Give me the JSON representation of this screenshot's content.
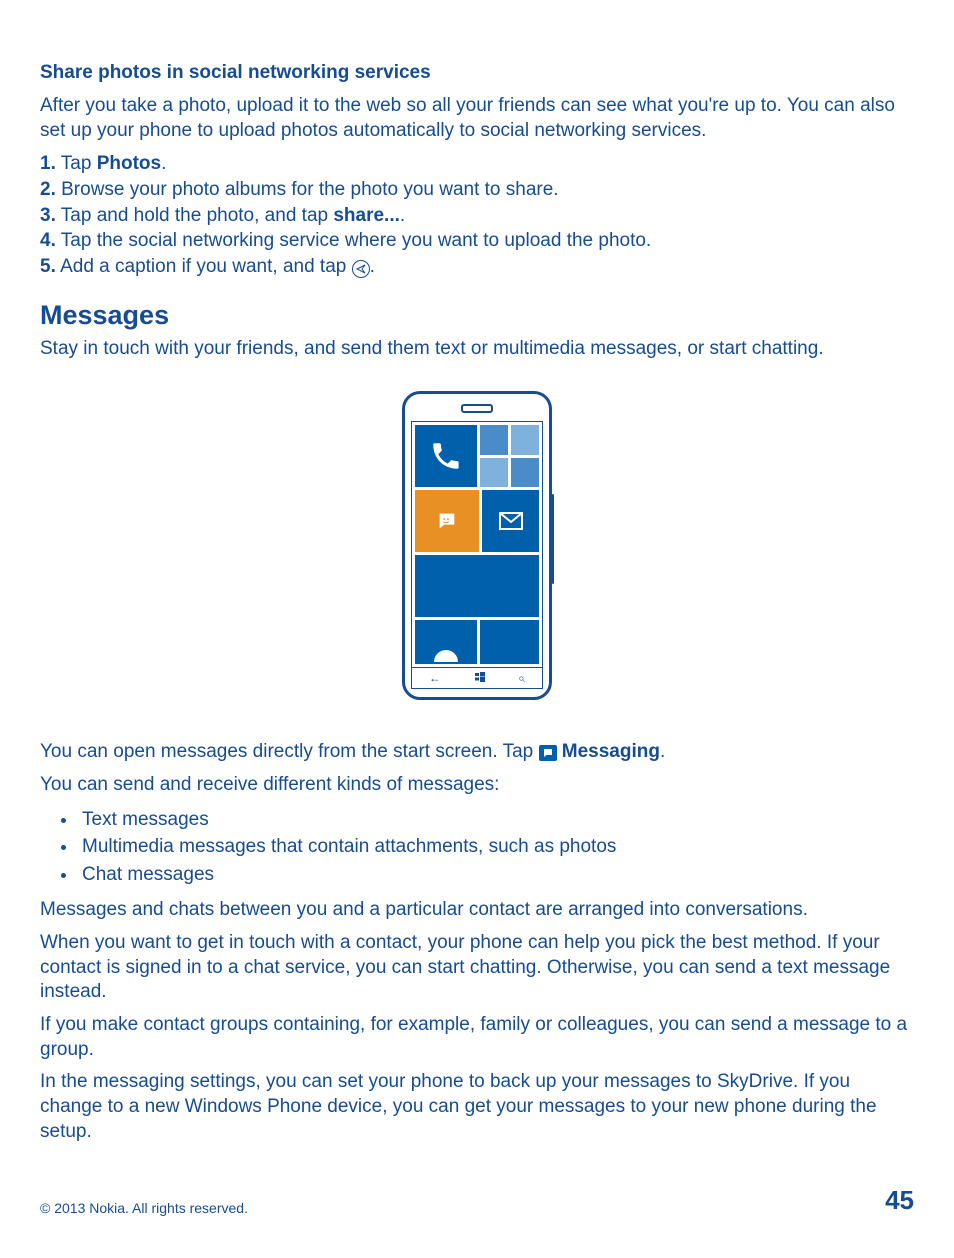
{
  "section1": {
    "title": "Share photos in social networking services",
    "intro": "After you take a photo, upload it to the web so all your friends can see what you're up to. You can also set up your phone to upload photos automatically to social networking services.",
    "steps": {
      "n1": "1.",
      "s1a": " Tap ",
      "s1b": "Photos",
      "s1c": ".",
      "n2": "2.",
      "s2": " Browse your photo albums for the photo you want to share.",
      "n3": "3.",
      "s3a": " Tap and hold the photo, and tap ",
      "s3b": "share...",
      "s3c": ".",
      "n4": "4.",
      "s4": " Tap the social networking service where you want to upload the photo.",
      "n5": "5.",
      "s5a": " Add a caption if you want, and tap ",
      "s5b": "."
    }
  },
  "section2": {
    "title": "Messages",
    "intro": "Stay in touch with your friends, and send them text or multimedia messages, or start chatting.",
    "open_a": "You can open messages directly from the start screen. Tap ",
    "open_b": " Messaging",
    "open_c": ".",
    "kinds_intro": "You can send and receive different kinds of messages:",
    "bullets": {
      "b1": "Text messages",
      "b2": "Multimedia messages that contain attachments, such as photos",
      "b3": "Chat messages"
    },
    "para1": "Messages and chats between you and a particular contact are arranged into conversations.",
    "para2": "When you want to get in touch with a contact, your phone can help you pick the best method. If your contact is signed in to a chat service, you can start chatting. Otherwise, you can send a text message instead.",
    "para3": "If you make contact groups containing, for example, family or colleagues, you can send a message to a group.",
    "para4": "In the messaging settings, you can set your phone to back up your messages to SkyDrive. If you change to a new Windows Phone device, you can get your messages to your new phone during the setup."
  },
  "footer": {
    "copyright": "© 2013 Nokia. All rights reserved.",
    "page": "45"
  },
  "icons": {
    "msg": "messaging-icon",
    "send": "send-icon"
  },
  "nav": {
    "back": "←",
    "win": "⊞",
    "search": "⌕"
  }
}
